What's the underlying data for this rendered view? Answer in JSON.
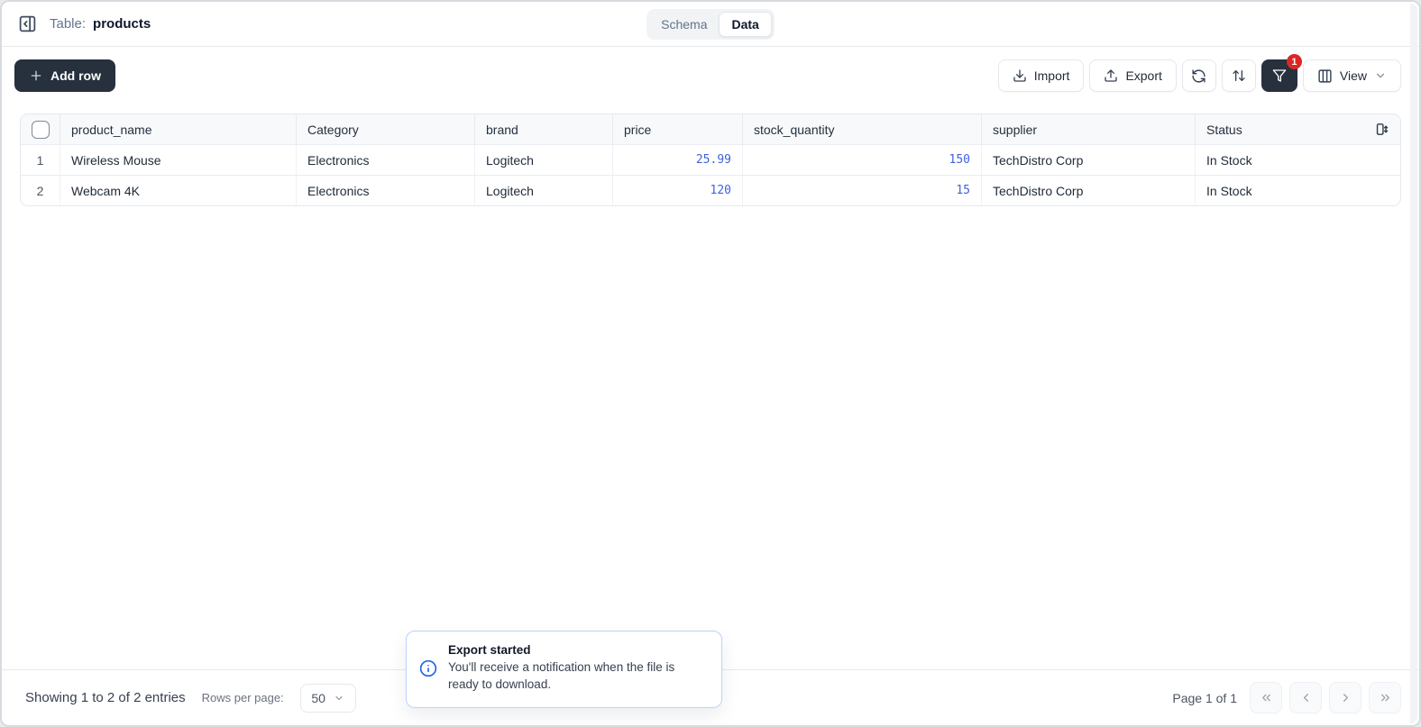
{
  "topbar": {
    "table_label": "Table:",
    "table_name": "products",
    "tabs": [
      {
        "label": "Schema",
        "active": false
      },
      {
        "label": "Data",
        "active": true
      }
    ]
  },
  "toolbar": {
    "add_row_label": "Add row",
    "import_label": "Import",
    "export_label": "Export",
    "filter_badge_count": "1",
    "view_label": "View"
  },
  "table": {
    "columns": [
      "product_name",
      "Category",
      "brand",
      "price",
      "stock_quantity",
      "supplier",
      "Status"
    ],
    "rows": [
      {
        "num": "1",
        "product_name": "Wireless Mouse",
        "category": "Electronics",
        "brand": "Logitech",
        "price": "25.99",
        "stock_quantity": "150",
        "supplier": "TechDistro Corp",
        "status": "In Stock"
      },
      {
        "num": "2",
        "product_name": "Webcam 4K",
        "category": "Electronics",
        "brand": "Logitech",
        "price": "120",
        "stock_quantity": "15",
        "supplier": "TechDistro Corp",
        "status": "In Stock"
      }
    ]
  },
  "footer": {
    "showing_text": "Showing 1 to 2 of 2 entries",
    "rows_per_page_label": "Rows per page:",
    "rows_per_page_value": "50",
    "page_info": "Page 1 of 1"
  },
  "toast": {
    "title": "Export started",
    "message": "You'll receive a notification when the file is ready to download."
  },
  "icons": {
    "sidebar_toggle": "panel-left-collapse-icon",
    "add_row": "plus-icon",
    "import": "download-icon",
    "export": "upload-icon",
    "refresh": "refresh-icon",
    "sort": "arrow-up-down-icon",
    "filter": "funnel-icon",
    "view": "columns-icon",
    "view_chevron": "chevron-down-icon",
    "header_right": "row-height-icon",
    "toast": "info-circle-icon",
    "pagination": [
      "chevrons-left-icon",
      "chevron-left-icon",
      "chevron-right-icon",
      "chevrons-right-icon"
    ]
  },
  "colors": {
    "accent_dark": "#27303d",
    "number_blue": "#3e63dd",
    "badge_red": "#dc2626",
    "toast_border": "#b9d4fb",
    "toast_icon_blue": "#2563eb",
    "header_bg": "#f7f9fb",
    "border": "#e4e8ed"
  }
}
